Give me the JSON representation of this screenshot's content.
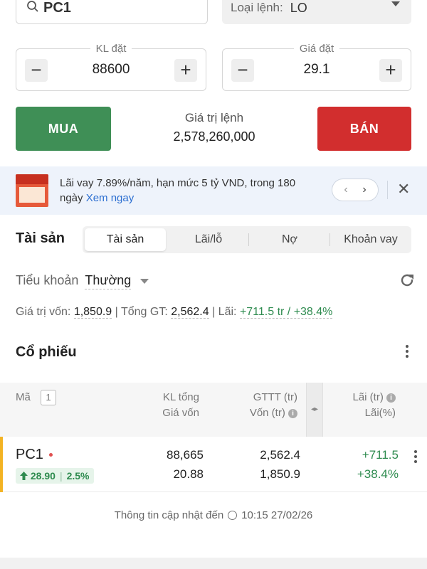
{
  "order_form": {
    "search_value": "PC1",
    "order_type_label": "Loại lệnh:",
    "order_type_value": "LO",
    "volume_label": "KL đặt",
    "volume_value": "88600",
    "price_label": "Giá đặt",
    "price_value": "29.1",
    "minus": "−",
    "plus": "+",
    "buy_label": "MUA",
    "sell_label": "BÁN",
    "order_value_label": "Giá trị lệnh",
    "order_value": "2,578,260,000"
  },
  "banner": {
    "text": "Lãi vay 7.89%/năm, hạn mức 5 tỷ VND, trong 180 ngày",
    "link": "Xem ngay",
    "prev": "‹",
    "next": "›",
    "close": "✕"
  },
  "assets": {
    "title": "Tài sản",
    "tabs": [
      "Tài sản",
      "Lãi/lỗ",
      "Nợ",
      "Khoản vay"
    ],
    "sub_account_label": "Tiểu khoản",
    "sub_account_value": "Thường",
    "capital_label": "Giá trị vốn:",
    "capital_value": "1,850.9",
    "total_label": "| Tổng GT:",
    "total_value": "2,562.4",
    "profit_label": "| Lãi:",
    "profit_value": "+711.5 tr / +38.4%"
  },
  "stocks": {
    "title": "Cổ phiếu",
    "header": {
      "ma": "Mã",
      "badge": "1",
      "kl_tong": "KL tổng",
      "gia_von": "Giá vốn",
      "gttt": "GTTT (tr)",
      "von": "Vốn (tr)",
      "lai_tr": "Lãi (tr)",
      "lai_pct": "Lãi(%)",
      "swap": "◂▸"
    },
    "rows": [
      {
        "symbol": "PC1",
        "price": "28.90",
        "change_pct": "2.5%",
        "kl_tong": "88,665",
        "gia_von": "20.88",
        "gttt": "2,562.4",
        "von": "1,850.9",
        "lai_tr": "+711.5",
        "lai_pct": "+38.4%"
      }
    ]
  },
  "footer": {
    "label": "Thông tin cập nhật đến",
    "time": "10:15 27/02/26"
  },
  "colors": {
    "buy": "#3f8f56",
    "sell": "#d22e2e",
    "gain": "#2e8b4f",
    "link": "#2c6fd1",
    "row_marker": "#f3b324"
  }
}
